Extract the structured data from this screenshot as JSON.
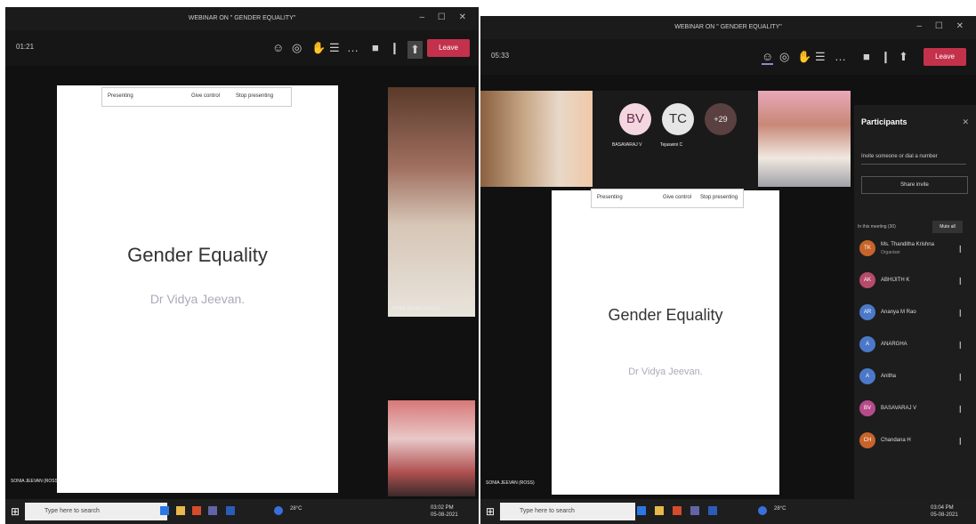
{
  "left_window": {
    "title": "WEBINAR ON \" GENDER EQUALITY\"",
    "timer": "01:21",
    "leave_label": "Leave",
    "share_bar": {
      "presenting": "Presenting",
      "give_control": "Give control",
      "stop_presenting": "Stop presenting"
    },
    "slide": {
      "title": "Gender Equality",
      "subtitle": "Dr Vidya Jeevan."
    },
    "video_label": "SONIA JEEVAN (ROSS)",
    "bottom_label": "SONIA JEEVAN (ROSS)"
  },
  "right_window": {
    "title": "WEBINAR ON \" GENDER EQUALITY\"",
    "timer": "05:33",
    "leave_label": "Leave",
    "share_bar": {
      "presenting": "Presenting",
      "give_control": "Give control",
      "stop_presenting": "Stop presenting"
    },
    "slide": {
      "title": "Gender Equality",
      "subtitle": "Dr Vidya Jeevan."
    },
    "avatars": [
      {
        "initials": "BV",
        "name": "BASAVARAJ V",
        "color": "#f3d6e0"
      },
      {
        "initials": "TC",
        "name": "Tejaswini C",
        "color": "#e6e6e6"
      },
      {
        "initials": "+29",
        "name": "",
        "color": "#5a4040"
      }
    ],
    "bottom_label": "SONIA JEEVAN (ROSS)",
    "participants": {
      "title": "Participants",
      "invite_placeholder": "Invite someone or dial a number",
      "share_invite": "Share invite",
      "section": "In this meeting (30)",
      "mute_all": "Mute all",
      "list": [
        {
          "name": "Ms. Thanditha Krishna",
          "sub": "Organiser",
          "initials": "TK",
          "color": "#c8642a"
        },
        {
          "name": "ABHIJITH K",
          "sub": "",
          "initials": "AK",
          "color": "#b64b6b"
        },
        {
          "name": "Ananya M Rao",
          "sub": "",
          "initials": "AR",
          "color": "#4b79c8"
        },
        {
          "name": "ANARGHA",
          "sub": "",
          "initials": "A",
          "color": "#4b79c8"
        },
        {
          "name": "Anitha",
          "sub": "",
          "initials": "A",
          "color": "#4b79c8"
        },
        {
          "name": "BASAVARAJ V",
          "sub": "",
          "initials": "BV",
          "color": "#b64b8b"
        },
        {
          "name": "Chandana H",
          "sub": "",
          "initials": "CH",
          "color": "#c8642a"
        }
      ]
    }
  },
  "taskbar": {
    "search_placeholder": "Type here to search",
    "weather": "28°C",
    "time_left": "03:02 PM",
    "date_left": "05-08-2021",
    "time_right": "03:04 PM",
    "date_right": "05-08-2021"
  }
}
